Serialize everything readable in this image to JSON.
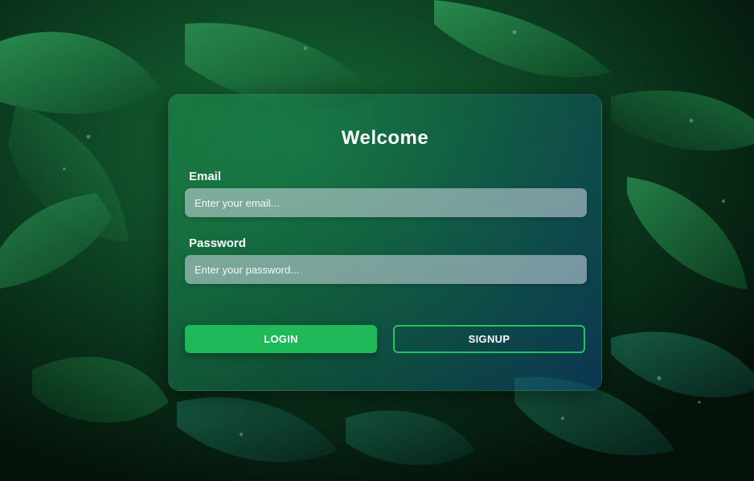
{
  "form": {
    "title": "Welcome",
    "email_label": "Email",
    "email_placeholder": "Enter your email...",
    "email_value": "",
    "password_label": "Password",
    "password_placeholder": "Enter your password...",
    "password_value": "",
    "login_label": "LOGIN",
    "signup_label": "SIGNUP"
  },
  "colors": {
    "accent_green": "#20b95a",
    "signup_border": "#22c25e",
    "text": "#ffffff"
  }
}
